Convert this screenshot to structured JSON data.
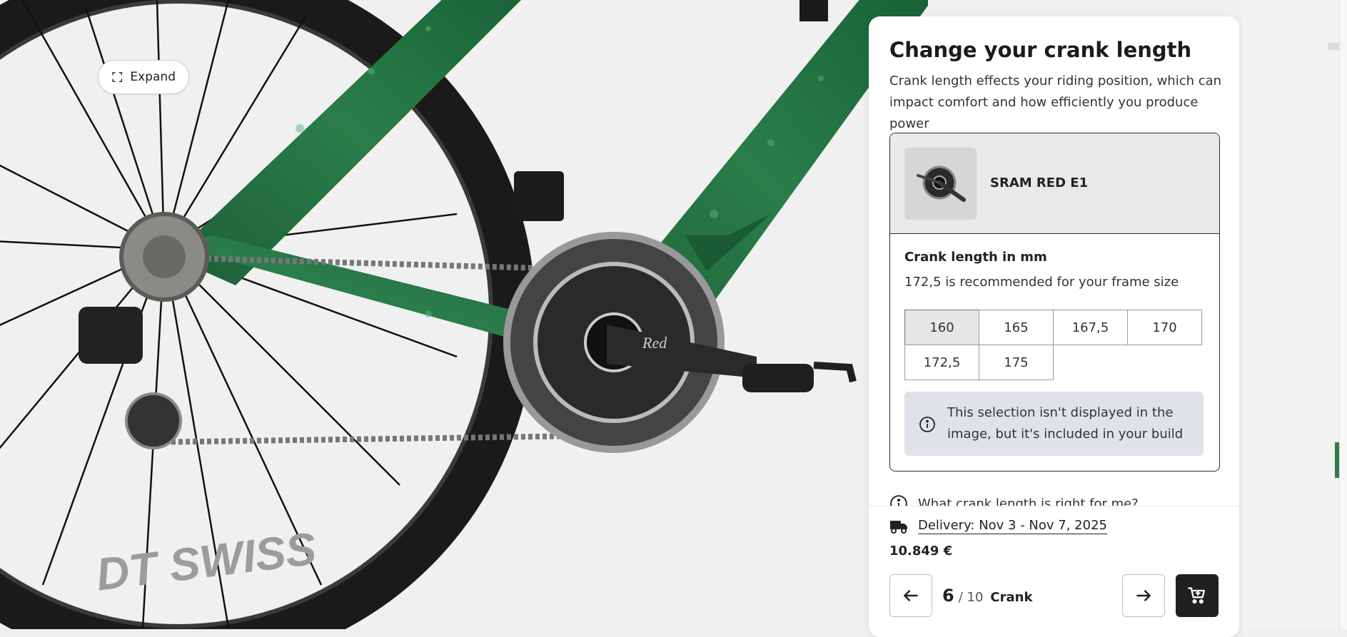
{
  "image": {
    "wheel_brand": "DT SWISS",
    "crank_brand": "Red"
  },
  "expand": {
    "label": "Expand"
  },
  "panel": {
    "title": "Change your crank length",
    "description": "Crank length effects your riding position, which can impact comfort and how efficiently you produce power",
    "product": {
      "name": "SRAM RED E1"
    },
    "length_label": "Crank length in mm",
    "recommendation": "172,5 is recommended for your frame size",
    "options": [
      "160",
      "165",
      "167,5",
      "170",
      "172,5",
      "175"
    ],
    "selected_option": "160",
    "notice": "This selection isn't displayed in the image, but it's included in your build",
    "help_link": "What crank length is right for me?"
  },
  "footer": {
    "delivery": "Delivery: Nov 3 - Nov 7, 2025",
    "price": "10.849 €",
    "step": {
      "current": "6",
      "total": "/ 10",
      "name": "Crank"
    }
  },
  "colors": {
    "frame_green": "#1f6b3e",
    "accent_dark": "#1f1f1f",
    "notice_bg": "#dfe3e7"
  }
}
